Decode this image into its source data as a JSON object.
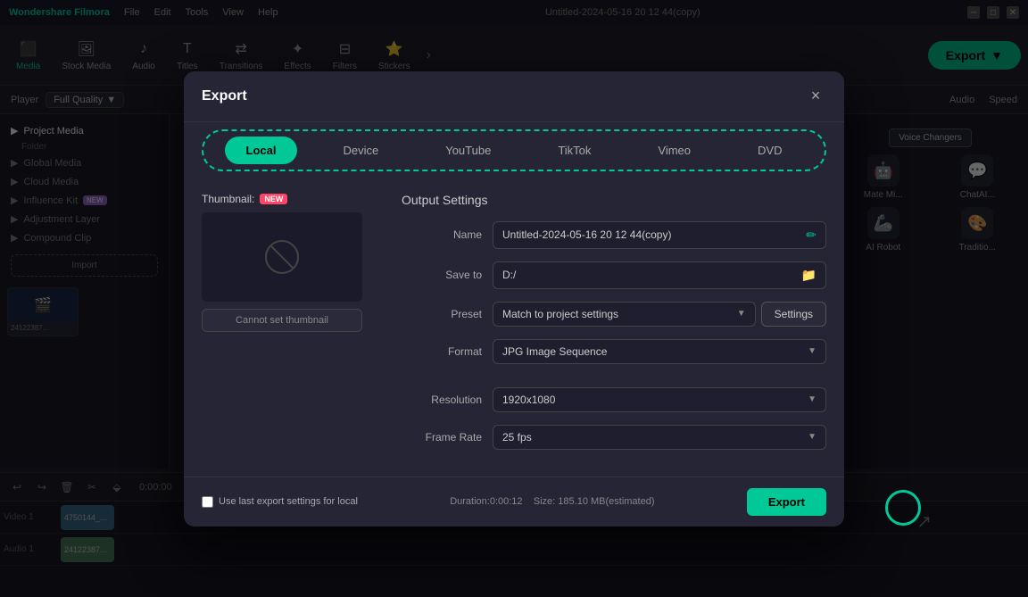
{
  "app": {
    "name": "Wondershare Filmora",
    "title": "Untitled-2024-05-16 20 12 44(copy)",
    "menu": [
      "File",
      "Edit",
      "Tools",
      "View",
      "Help"
    ]
  },
  "toolbar": {
    "items": [
      {
        "id": "media",
        "label": "Media",
        "icon": "🎬"
      },
      {
        "id": "stock-media",
        "label": "Stock Media",
        "icon": "🖼"
      },
      {
        "id": "audio",
        "label": "Audio",
        "icon": "🎵"
      },
      {
        "id": "titles",
        "label": "Titles",
        "icon": "T"
      },
      {
        "id": "transitions",
        "label": "Transitions",
        "icon": "⇄"
      },
      {
        "id": "effects",
        "label": "Effects",
        "icon": "✨"
      },
      {
        "id": "filters",
        "label": "Filters",
        "icon": "🔲"
      },
      {
        "id": "stickers",
        "label": "Stickers",
        "icon": "⭐"
      }
    ],
    "export_label": "Export",
    "export_chevron": "▼"
  },
  "player_bar": {
    "player_label": "Player",
    "quality_label": "Full Quality",
    "audio_label": "Audio",
    "speed_label": "Speed"
  },
  "sidebar": {
    "sections": [
      {
        "label": "Project Media"
      },
      {
        "label": "Folder"
      },
      {
        "label": "Global Media"
      },
      {
        "label": "Cloud Media"
      },
      {
        "label": "Influence Kit"
      },
      {
        "label": "Adjustment Layer"
      },
      {
        "label": "Compound Clip"
      }
    ],
    "import_label": "Import"
  },
  "right_panel": {
    "tools": [
      {
        "label": "Mate Mi...",
        "icon": "🤖"
      },
      {
        "label": "ChatAI...",
        "icon": "💬"
      },
      {
        "label": "AI Robot",
        "icon": "🤖"
      },
      {
        "label": "Traditio...",
        "icon": "🎨"
      }
    ]
  },
  "export_dialog": {
    "title": "Export",
    "close_label": "×",
    "tabs": [
      {
        "id": "local",
        "label": "Local",
        "active": true
      },
      {
        "id": "device",
        "label": "Device"
      },
      {
        "id": "youtube",
        "label": "YouTube"
      },
      {
        "id": "tiktok",
        "label": "TikTok"
      },
      {
        "id": "vimeo",
        "label": "Vimeo"
      },
      {
        "id": "dvd",
        "label": "DVD"
      }
    ],
    "thumbnail": {
      "label": "Thumbnail:",
      "new_badge": "NEW",
      "no_set_label": "Cannot set thumbnail"
    },
    "output_settings": {
      "title": "Output Settings",
      "fields": {
        "name_label": "Name",
        "name_value": "Untitled-2024-05-16 20 12 44(copy)",
        "save_to_label": "Save to",
        "save_to_value": "D:/",
        "preset_label": "Preset",
        "preset_value": "Match to project settings",
        "format_label": "Format",
        "format_value": "JPG Image Sequence",
        "resolution_label": "Resolution",
        "resolution_value": "1920x1080",
        "frame_rate_label": "Frame Rate",
        "frame_rate_value": "25 fps"
      },
      "settings_btn": "Settings"
    },
    "footer": {
      "checkbox_label": "Use last export settings for local",
      "duration_label": "Duration:0:00:12",
      "size_label": "Size: 185.10 MB(estimated)",
      "export_btn": "Export"
    }
  },
  "timeline": {
    "tracks": [
      {
        "label": "Video 1",
        "type": "video"
      },
      {
        "label": "Audio 1",
        "type": "audio"
      }
    ]
  }
}
